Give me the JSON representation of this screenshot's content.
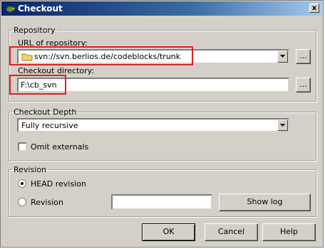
{
  "window": {
    "title": "Checkout",
    "close_label": "x"
  },
  "repository": {
    "group_label": "Repository",
    "url_label": "URL of repository:",
    "url_value": "svn://svn.berlios.de/codeblocks/trunk",
    "dir_label": "Checkout directory:",
    "dir_value": "F:\\cb_svn",
    "browse_label": "..."
  },
  "depth": {
    "group_label": "Checkout Depth",
    "selected": "Fully recursive",
    "omit_label": "Omit externals"
  },
  "revision": {
    "group_label": "Revision",
    "head_label": "HEAD revision",
    "revision_label": "Revision",
    "revision_value": "",
    "showlog_label": "Show log"
  },
  "buttons": {
    "ok": "OK",
    "cancel": "Cancel",
    "help": "Help"
  },
  "colors": {
    "highlight": "#e02020",
    "titlebar": "#0a246a"
  }
}
